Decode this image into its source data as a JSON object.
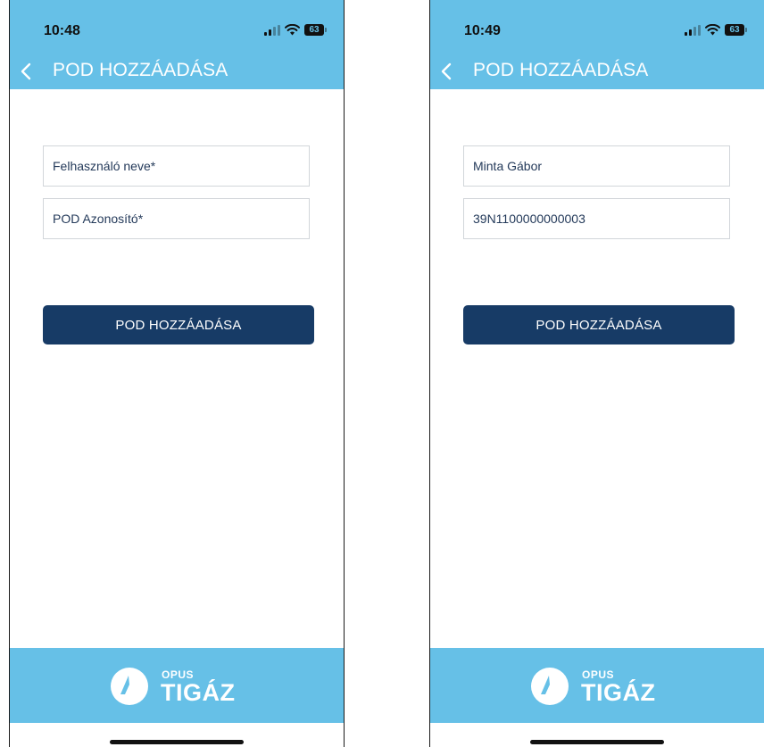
{
  "screens": [
    {
      "status": {
        "time": "10:48",
        "battery": "63"
      },
      "header": {
        "title": "POD HOZZÁADÁSA"
      },
      "form": {
        "user_name": {
          "value": "",
          "placeholder": "Felhasználó neve*"
        },
        "pod_id": {
          "value": "",
          "placeholder": "POD Azonosító*"
        },
        "submit_label": "POD HOZZÁADÁSA"
      },
      "footer": {
        "brand_small": "OPUS",
        "brand_large": "TIGÁZ"
      }
    },
    {
      "status": {
        "time": "10:49",
        "battery": "63"
      },
      "header": {
        "title": "POD HOZZÁADÁSA"
      },
      "form": {
        "user_name": {
          "value": "Minta Gábor",
          "placeholder": ""
        },
        "pod_id": {
          "value": "39N1100000000003",
          "placeholder": ""
        },
        "submit_label": "POD HOZZÁADÁSA"
      },
      "footer": {
        "brand_small": "OPUS",
        "brand_large": "TIGÁZ"
      }
    }
  ],
  "colors": {
    "header_bg": "#66c0e7",
    "button_bg": "#173b66",
    "field_text": "#243a5a",
    "field_border": "#d2d6da"
  }
}
